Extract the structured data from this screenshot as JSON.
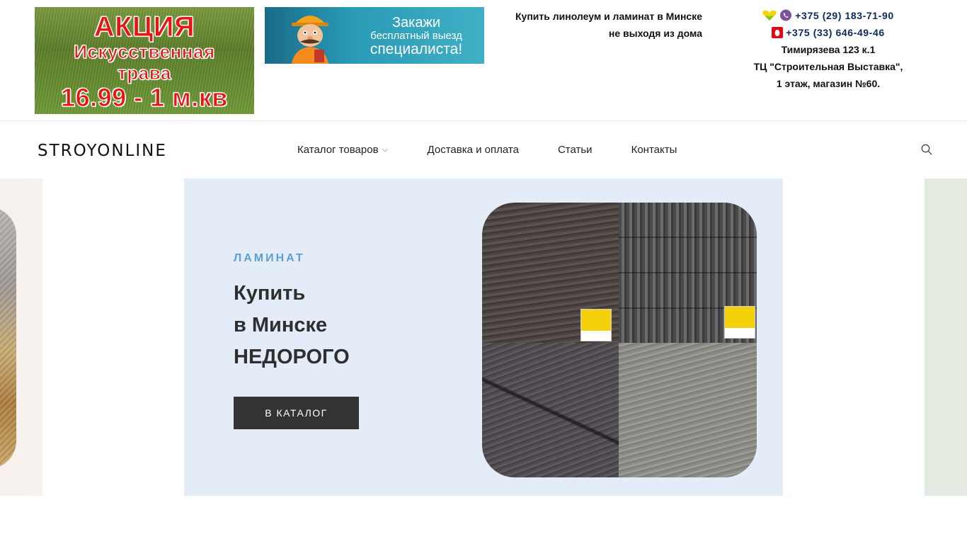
{
  "promo_banner": {
    "line1": "АКЦИЯ",
    "line2": "Искусственная",
    "line3": "трава",
    "line4": "16.99 - 1 м.кв"
  },
  "specialist_banner": {
    "line1": "Закажи",
    "line2": "бесплатный выезд",
    "line3": "специалиста!"
  },
  "slogan": {
    "line1": "Купить линолеум и ламинат в Минске",
    "line2": "не выходя из дома"
  },
  "contacts": {
    "phone_velcom": "+375 (29) 183-71-90",
    "phone_mts": "+375 (33) 646-49-46",
    "address_line1": "Тимирязева 123 к.1",
    "address_line2": "ТЦ \"Строительная Выставка\",",
    "address_line3": "1 этаж, магазин №60."
  },
  "nav": {
    "logo": "STROYONLINE",
    "items": [
      {
        "label": "Каталог товаров",
        "has_dropdown": true
      },
      {
        "label": "Доставка и оплата"
      },
      {
        "label": "Статьи"
      },
      {
        "label": "Контакты"
      }
    ]
  },
  "hero": {
    "category": "ЛАМИНАТ",
    "title_line1": "Купить",
    "title_line2": "в Минске",
    "title_line3": "НЕДОРОГО",
    "button_label": "В КАТАЛОГ"
  },
  "icons": {
    "velcom": "velcom-heart-icon",
    "viber": "viber-icon",
    "mts": "mts-egg-icon",
    "search": "search-icon",
    "dropdown": "chevron-down-icon"
  },
  "colors": {
    "accent_blue": "#5c9fd8",
    "phone_blue": "#0b2a5c",
    "hero_bg": "#e4edf7",
    "button_bg": "#333333"
  }
}
